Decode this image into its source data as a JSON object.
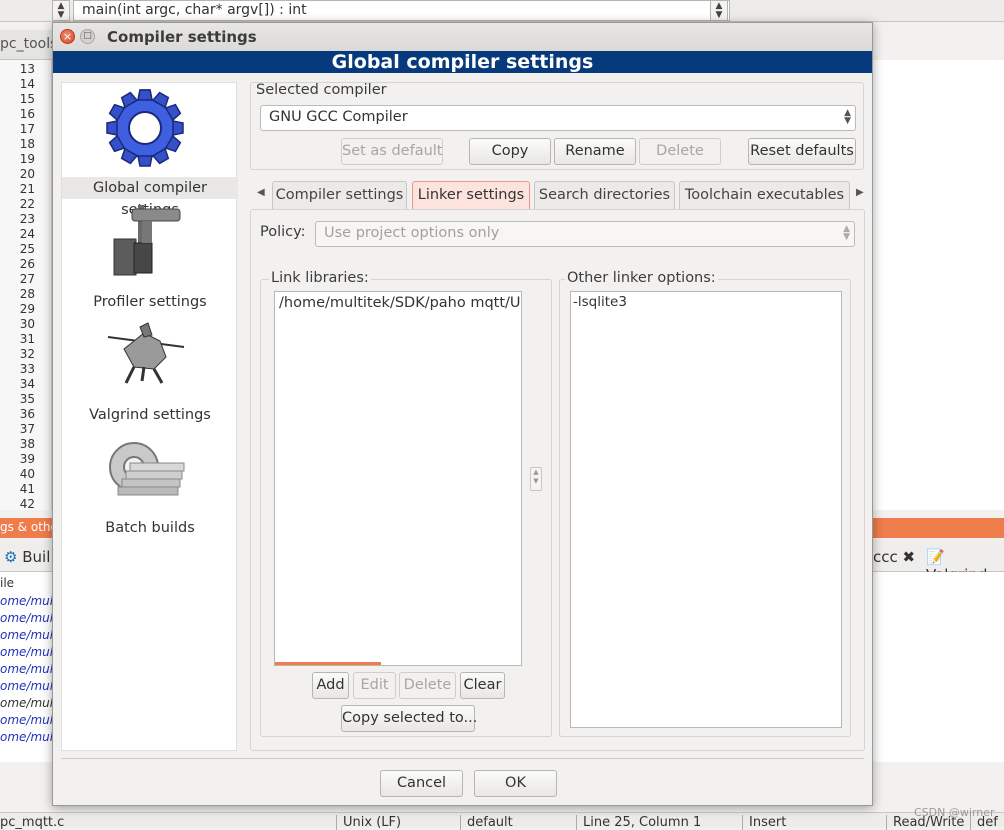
{
  "background": {
    "function_combo": "main(int argc, char* argv[]) : int",
    "editor_tab": "pc_tools",
    "line_numbers": [
      "13",
      "14",
      "15",
      "16",
      "17",
      "18",
      "19",
      "20",
      "21",
      "22",
      "23",
      "24",
      "25",
      "26",
      "27",
      "28",
      "29",
      "30",
      "31",
      "32",
      "33",
      "34",
      "35",
      "36",
      "37",
      "38",
      "39",
      "40",
      "41",
      "42"
    ],
    "panel_title": "gs & othe",
    "log_tab_build": "Buil",
    "log_tab_cccc": "ccc",
    "log_tab_valgrind": "Valgrind",
    "log_header": "ile",
    "log_lines": [
      "ome/mult",
      "ome/mult",
      "ome/mult",
      "ome/mult",
      "ome/mult",
      "ome/mult",
      "ome/mult",
      "ome/mult",
      "ome/mult"
    ],
    "status": {
      "file": "pc_mqtt.c",
      "eol": "Unix (LF)",
      "encoding": "default",
      "position": "Line 25, Column 1",
      "mode": "Insert",
      "access": "Read/Write",
      "extra": "def"
    },
    "watermark": "CSDN @wirner"
  },
  "dialog": {
    "title": "Compiler settings",
    "header": "Global compiler settings",
    "categories": [
      {
        "label": "Global compiler settings",
        "icon": "gear-icon"
      },
      {
        "label": "Profiler settings",
        "icon": "caliper-icon"
      },
      {
        "label": "Valgrind settings",
        "icon": "knight-icon"
      },
      {
        "label": "Batch builds",
        "icon": "batch-gear-icon"
      }
    ],
    "selected_compiler_label": "Selected compiler",
    "compiler_value": "GNU GCC Compiler",
    "buttons": {
      "set_default": "Set as default",
      "copy": "Copy",
      "rename": "Rename",
      "delete": "Delete",
      "reset_defaults": "Reset defaults",
      "cancel": "Cancel",
      "ok": "OK"
    },
    "tabs": [
      "Compiler settings",
      "Linker settings",
      "Search directories",
      "Toolchain executables"
    ],
    "policy_label": "Policy:",
    "policy_value": "Use project options only",
    "link_libraries_label": "Link libraries:",
    "link_libraries": [
      "/home/multitek/SDK/paho mqtt/Ur"
    ],
    "link_buttons": {
      "add": "Add",
      "edit": "Edit",
      "delete": "Delete",
      "clear": "Clear",
      "copy_selected": "Copy selected to..."
    },
    "other_options_label": "Other linker options:",
    "other_options": "-lsqlite3"
  }
}
